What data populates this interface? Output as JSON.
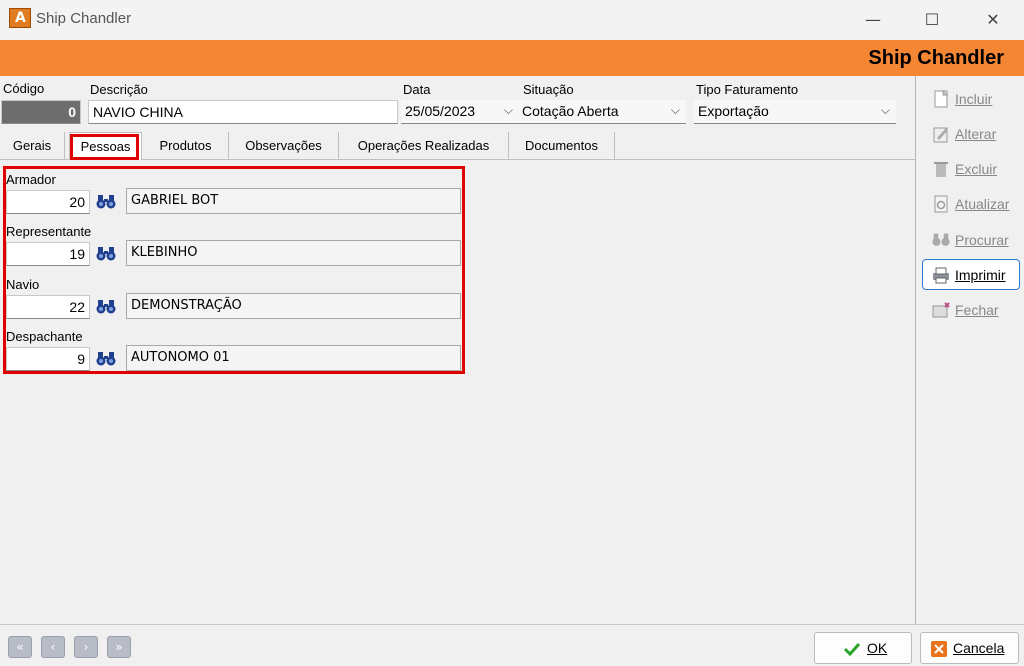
{
  "window": {
    "title": "Ship Chandler",
    "minimize": "—",
    "maximize": "☐",
    "close": "✕"
  },
  "banner": {
    "title": "Ship Chandler"
  },
  "header": {
    "codigo_label": "Código",
    "codigo_value": "0",
    "descricao_label": "Descrição",
    "descricao_value": "NAVIO CHINA",
    "data_label": "Data",
    "data_value": "25/05/2023",
    "situacao_label": "Situação",
    "situacao_value": "Cotação Aberta",
    "tipo_label": "Tipo Faturamento",
    "tipo_value": "Exportação"
  },
  "tabs": [
    "Gerais",
    "Pessoas",
    "Produtos",
    "Observações",
    "Operações Realizadas",
    "Documentos"
  ],
  "active_tab": "Pessoas",
  "people": [
    {
      "label": "Armador",
      "code": "20",
      "name": "GABRIEL BOT"
    },
    {
      "label": "Representante",
      "code": "19",
      "name": " KLEBINHO"
    },
    {
      "label": "Navio",
      "code": "22",
      "name": "DEMONSTRAÇÃO"
    },
    {
      "label": "Despachante",
      "code": "9",
      "name": "AUTONOMO 01"
    }
  ],
  "sidebar": {
    "incluir": "Incluir",
    "alterar": "Alterar",
    "excluir": "Excluir",
    "atualizar": "Atualizar",
    "procurar": "Procurar",
    "imprimir": "Imprimir",
    "fechar": "Fechar"
  },
  "footer": {
    "nav_first": "«",
    "nav_prev": "‹",
    "nav_next": "›",
    "nav_last": "»",
    "ok": "OK",
    "cancel": "Cancela"
  },
  "colors": {
    "banner": "#f58634",
    "highlight": "#e00000",
    "accent": "#2f7bd0"
  }
}
